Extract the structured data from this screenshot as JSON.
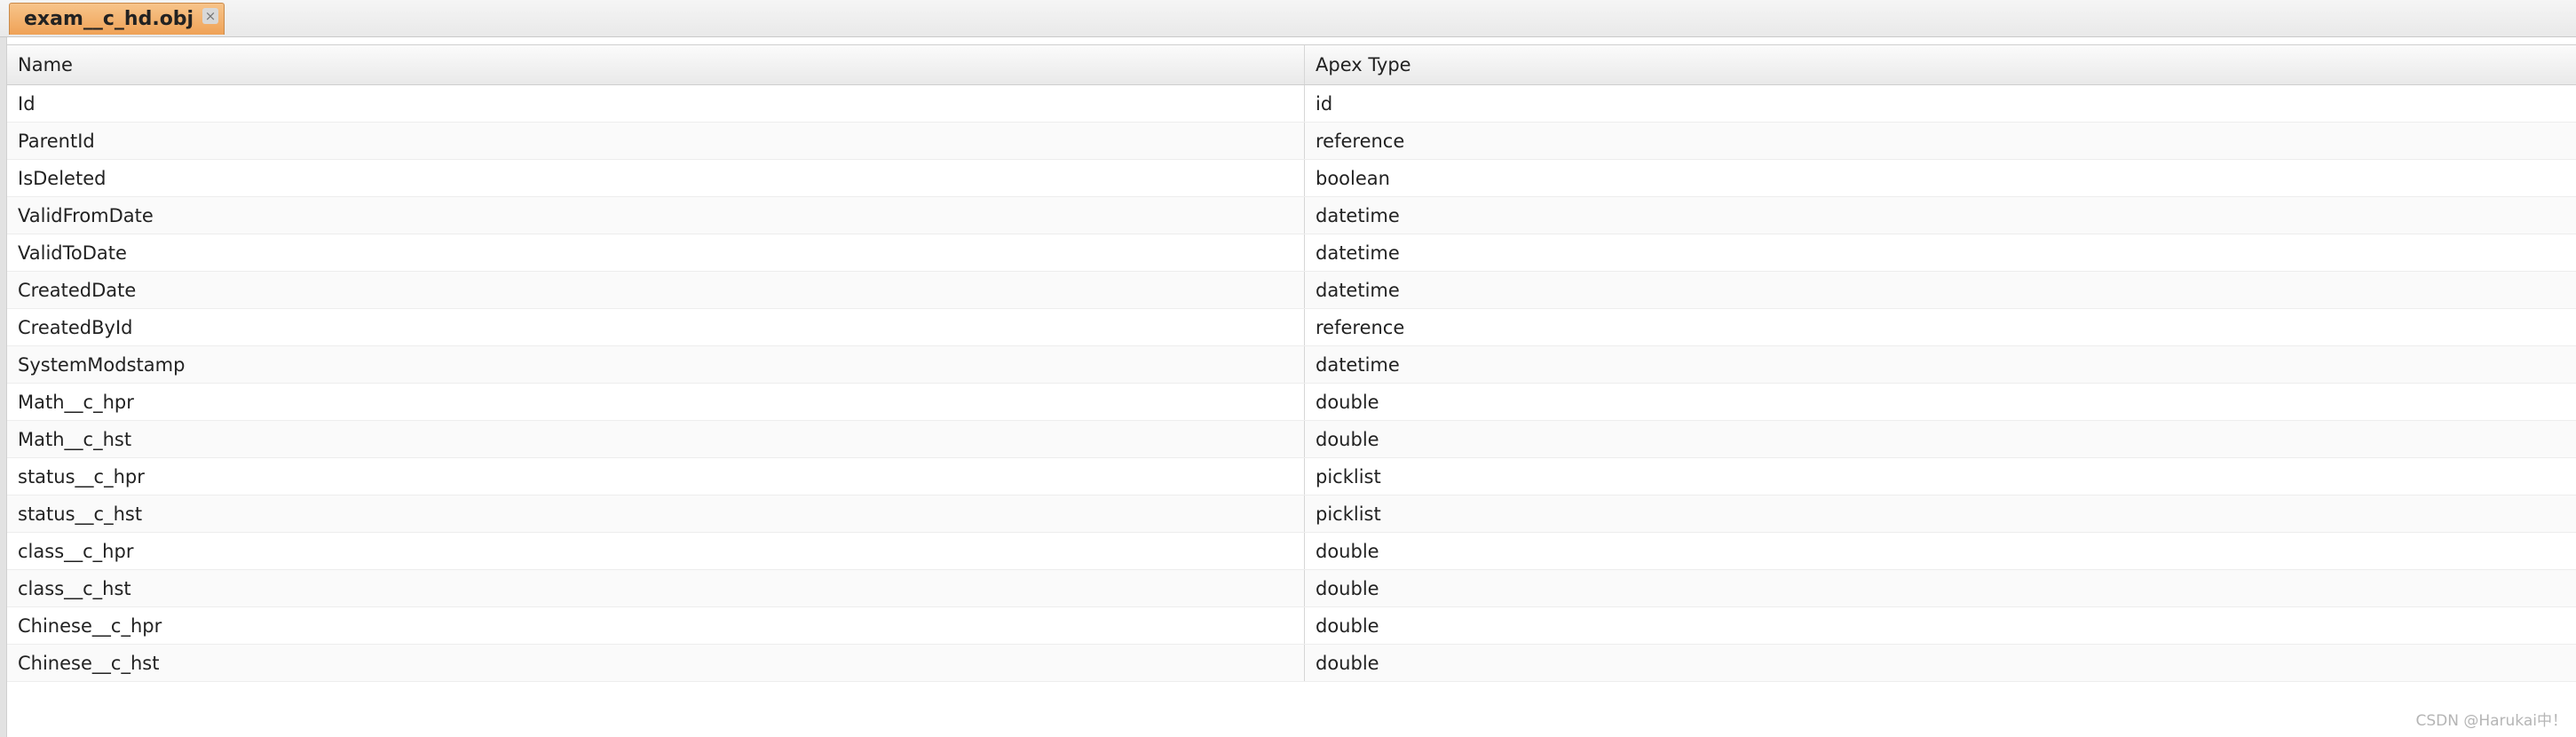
{
  "tab": {
    "title": "exam__c_hd.obj",
    "close_glyph": "×"
  },
  "table": {
    "columns": [
      "Name",
      "Apex Type"
    ],
    "rows": [
      {
        "name": "Id",
        "type": "id"
      },
      {
        "name": "ParentId",
        "type": "reference"
      },
      {
        "name": "IsDeleted",
        "type": "boolean"
      },
      {
        "name": "ValidFromDate",
        "type": "datetime"
      },
      {
        "name": "ValidToDate",
        "type": "datetime"
      },
      {
        "name": "CreatedDate",
        "type": "datetime"
      },
      {
        "name": "CreatedById",
        "type": "reference"
      },
      {
        "name": "SystemModstamp",
        "type": "datetime"
      },
      {
        "name": "Math__c_hpr",
        "type": "double"
      },
      {
        "name": "Math__c_hst",
        "type": "double"
      },
      {
        "name": "status__c_hpr",
        "type": "picklist"
      },
      {
        "name": "status__c_hst",
        "type": "picklist"
      },
      {
        "name": "class__c_hpr",
        "type": "double"
      },
      {
        "name": "class__c_hst",
        "type": "double"
      },
      {
        "name": "Chinese__c_hpr",
        "type": "double"
      },
      {
        "name": "Chinese__c_hst",
        "type": "double"
      }
    ]
  },
  "watermark": "CSDN @Harukai中！",
  "colors": {
    "tab_active": "#efa257",
    "header_bg": "#eeeeee",
    "row_alt": "#fafafa"
  }
}
